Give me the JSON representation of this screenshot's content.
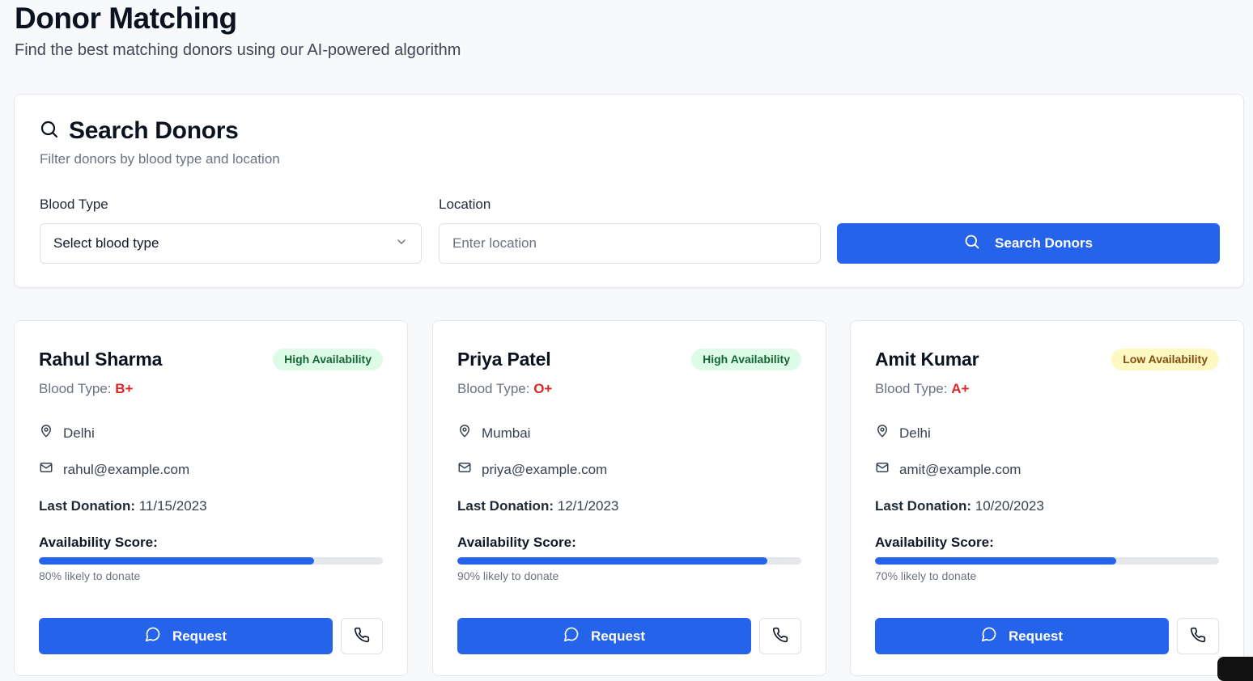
{
  "header": {
    "title": "Donor Matching",
    "subtitle": "Find the best matching donors using our AI-powered algorithm"
  },
  "search": {
    "title": "Search Donors",
    "description": "Filter donors by blood type and location",
    "blood_type_label": "Blood Type",
    "blood_type_value": "Select blood type",
    "location_label": "Location",
    "location_placeholder": "Enter location",
    "button_label": "Search Donors"
  },
  "donors": [
    {
      "name": "Rahul Sharma",
      "availability_badge": "High Availability",
      "availability_level": "high",
      "blood_type_label": "Blood Type: ",
      "blood_type": "B+",
      "location": "Delhi",
      "email": "rahul@example.com",
      "last_donation_label": "Last Donation:",
      "last_donation": "11/15/2023",
      "score_label": "Availability Score:",
      "score_fraction": 0.8,
      "score_text": "80% likely to donate",
      "request_label": "Request"
    },
    {
      "name": "Priya Patel",
      "availability_badge": "High Availability",
      "availability_level": "high",
      "blood_type_label": "Blood Type: ",
      "blood_type": "O+",
      "location": "Mumbai",
      "email": "priya@example.com",
      "last_donation_label": "Last Donation:",
      "last_donation": "12/1/2023",
      "score_label": "Availability Score:",
      "score_fraction": 0.9,
      "score_text": "90% likely to donate",
      "request_label": "Request"
    },
    {
      "name": "Amit Kumar",
      "availability_badge": "Low Availability",
      "availability_level": "low",
      "blood_type_label": "Blood Type: ",
      "blood_type": "A+",
      "location": "Delhi",
      "email": "amit@example.com",
      "last_donation_label": "Last Donation:",
      "last_donation": "10/20/2023",
      "score_label": "Availability Score:",
      "score_fraction": 0.7,
      "score_text": "70% likely to donate",
      "request_label": "Request"
    }
  ],
  "colors": {
    "primary": "#2563eb",
    "blood_type": "#dc2626",
    "high_badge_bg": "#dcfce7",
    "high_badge_text": "#166534",
    "low_badge_bg": "#fef9c3",
    "low_badge_text": "#854d0e"
  },
  "icons": {
    "search": "search-icon",
    "dropdown": "chevron-down-icon",
    "location": "map-pin-icon",
    "email": "mail-icon",
    "request": "message-circle-icon",
    "call": "phone-icon"
  }
}
